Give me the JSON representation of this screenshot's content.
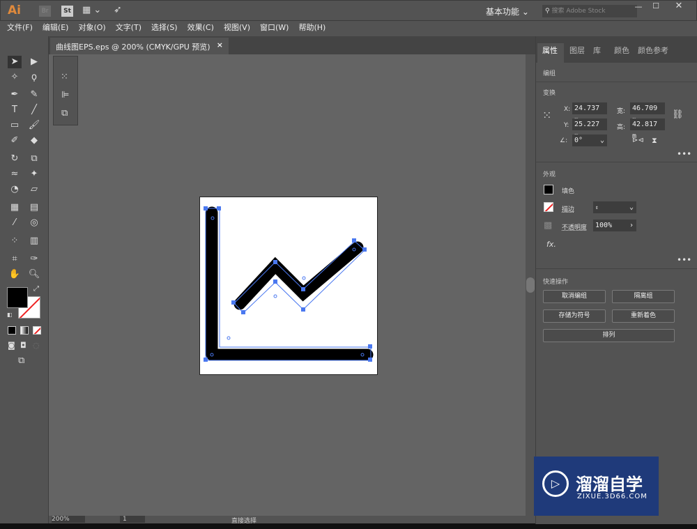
{
  "app": {
    "logo": "Ai",
    "br": "Br",
    "st": "St",
    "workspace": "基本功能",
    "search_placeholder": "搜索 Adobe Stock"
  },
  "menu": [
    "文件(F)",
    "编辑(E)",
    "对象(O)",
    "文字(T)",
    "选择(S)",
    "效果(C)",
    "视图(V)",
    "窗口(W)",
    "帮助(H)"
  ],
  "document": {
    "tab_title": "曲线图EPS.eps @ 200% (CMYK/GPU 预览)",
    "close": "×"
  },
  "panel": {
    "tabs": [
      "属性",
      "图层",
      "库",
      "颜色",
      "颜色参考"
    ],
    "active_tab": "属性",
    "selection_type": "编组",
    "transform": {
      "title": "变换",
      "x_label": "X:",
      "x": "24.737 m",
      "y_label": "Y:",
      "y": "25.227 m",
      "w_label": "宽:",
      "w": "46.709 m",
      "h_label": "高:",
      "h": "42.817 m",
      "angle_label": "∠:",
      "angle": "0°"
    },
    "appearance": {
      "title": "外观",
      "fill_label": "填色",
      "stroke_label": "描边",
      "opacity_label": "不透明度",
      "opacity": "100%",
      "fx": "fx."
    },
    "quick_actions": {
      "title": "快速操作",
      "buttons": [
        "取消编组",
        "隔离组",
        "存储为符号",
        "重新着色",
        "排列"
      ]
    }
  },
  "status": {
    "zoom": "200%",
    "artboard": "1",
    "tool": "直接选择"
  },
  "watermark": {
    "title": "溜溜自学",
    "url": "ZIXUE.3D66.COM"
  },
  "colors": {
    "accent": "#4a78f0",
    "fill": "#000000",
    "ui": "#535353",
    "canvas": "#646464"
  }
}
